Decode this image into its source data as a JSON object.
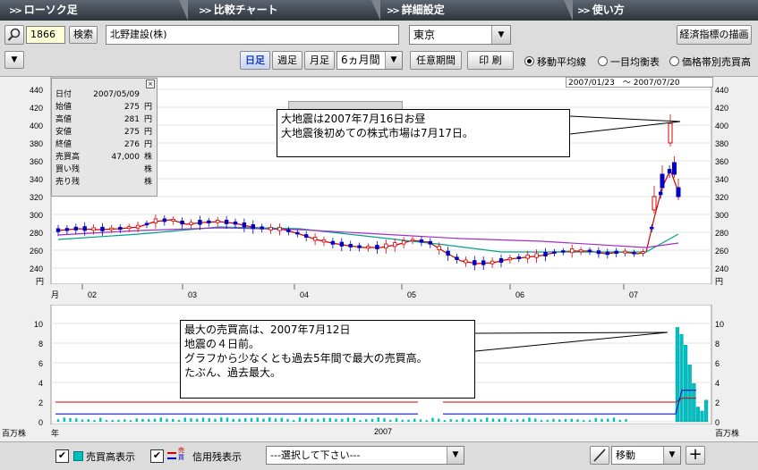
{
  "tabs": [
    {
      "label": "ローソク足",
      "active": true
    },
    {
      "label": "比較チャート"
    },
    {
      "label": "詳細設定"
    },
    {
      "label": "使い方"
    }
  ],
  "toolbar": {
    "code": "1866",
    "search_label": "検索",
    "company": "北野建設(株)",
    "market": "東京",
    "indicator_button": "経済指標の描画",
    "period_buttons": [
      "日足",
      "週足",
      "月足"
    ],
    "active_period": "日足",
    "range_select": "6ヵ月間",
    "custom_period": "任意期間",
    "print": "印 刷",
    "radios": [
      {
        "label": "移動平均線",
        "checked": true
      },
      {
        "label": "一目均衡表",
        "checked": false
      },
      {
        "label": "価格帯別売買高",
        "checked": false
      }
    ]
  },
  "date_range": "2007/01/23　～ 2007/07/20",
  "price_axis": {
    "ticks": [
      "440",
      "420",
      "400",
      "380",
      "360",
      "340",
      "320",
      "300",
      "280",
      "260",
      "240"
    ],
    "unit": "円"
  },
  "volume_axis": {
    "ticks": [
      "10",
      "8",
      "6",
      "4",
      "2",
      "0"
    ],
    "unit": "百万株"
  },
  "month_axis": {
    "label": "月",
    "months": [
      "02",
      "03",
      "04",
      "05",
      "06",
      "07"
    ]
  },
  "year_axis": {
    "label": "年",
    "year": "2007"
  },
  "info": {
    "rows": [
      {
        "k": "日付",
        "v": "2007/05/09",
        "u": ""
      },
      {
        "k": "始値",
        "v": "275",
        "u": "円"
      },
      {
        "k": "高値",
        "v": "281",
        "u": "円"
      },
      {
        "k": "安値",
        "v": "275",
        "u": "円"
      },
      {
        "k": "終値",
        "v": "276",
        "u": "円"
      },
      {
        "k": "売買高",
        "v": "47,000",
        "u": "株"
      },
      {
        "k": "買い残",
        "v": "",
        "u": "株"
      },
      {
        "k": "売り残",
        "v": "",
        "u": "株"
      }
    ]
  },
  "annotations": {
    "top": [
      "大地震は2007年7月16日お昼",
      "大地震後初めての株式市場は7月17日。"
    ],
    "bottom": [
      "最大の売買高は、2007年7月12日",
      "地震の４日前。",
      "グラフから少なくとも過去5年間で最大の売買高。",
      "たぶん、過去最大。"
    ]
  },
  "bottom": {
    "volume_label": "売買高表示",
    "volume_icon_color": "#00c0c0",
    "credit_label": "信用残表示",
    "credit_legend": [
      "売",
      "買"
    ],
    "select": "---選択して下さい---",
    "draw_mode": "移動"
  },
  "chart_data": [
    {
      "type": "line",
      "name": "price",
      "ylabel": "円",
      "ylim": [
        230,
        450
      ],
      "x_range": [
        "2007/01/23",
        "2007/07/20"
      ],
      "series": [
        {
          "name": "close",
          "color": "#d40000",
          "values": [
            [
              0,
              282
            ],
            [
              5,
              284
            ],
            [
              10,
              283
            ],
            [
              15,
              284
            ],
            [
              20,
              286
            ],
            [
              24,
              292
            ],
            [
              28,
              294
            ],
            [
              32,
              289
            ],
            [
              36,
              291
            ],
            [
              40,
              292
            ],
            [
              44,
              290
            ],
            [
              48,
              286
            ],
            [
              52,
              284
            ],
            [
              56,
              283
            ],
            [
              60,
              278
            ],
            [
              64,
              272
            ],
            [
              68,
              268
            ],
            [
              72,
              265
            ],
            [
              76,
              263
            ],
            [
              80,
              263
            ],
            [
              84,
              266
            ],
            [
              88,
              271
            ],
            [
              92,
              269
            ],
            [
              96,
              258
            ],
            [
              100,
              248
            ],
            [
              104,
              245
            ],
            [
              108,
              246
            ],
            [
              112,
              250
            ],
            [
              116,
              252
            ],
            [
              120,
              254
            ],
            [
              124,
              258
            ],
            [
              128,
              259
            ],
            [
              132,
              259
            ],
            [
              136,
              256
            ],
            [
              140,
              258
            ],
            [
              144,
              256
            ],
            [
              146,
              258
            ],
            [
              148,
              296
            ],
            [
              150,
              330
            ],
            [
              152,
              350
            ],
            [
              154,
              325
            ]
          ]
        },
        {
          "name": "ma-teal",
          "color": "#00a090",
          "values": [
            [
              0,
              272
            ],
            [
              20,
              278
            ],
            [
              40,
              286
            ],
            [
              60,
              284
            ],
            [
              80,
              274
            ],
            [
              96,
              266
            ],
            [
              110,
              258
            ],
            [
              130,
              258
            ],
            [
              146,
              258
            ],
            [
              154,
              278
            ]
          ]
        },
        {
          "name": "ma-purple",
          "color": "#a030c0",
          "values": [
            [
              0,
              277
            ],
            [
              20,
              282
            ],
            [
              40,
              285
            ],
            [
              60,
              283
            ],
            [
              80,
              278
            ],
            [
              100,
              273
            ],
            [
              120,
              270
            ],
            [
              146,
              263
            ],
            [
              154,
              268
            ]
          ]
        }
      ]
    },
    {
      "type": "bar",
      "name": "volume",
      "ylabel": "百万株",
      "ylim": [
        0,
        10
      ],
      "highlight_values": [
        9.6,
        8.9,
        7.8,
        5.8,
        3.9,
        1.5,
        1.1,
        2.2
      ],
      "credit_lines": [
        {
          "name": "売",
          "color": "#d40000",
          "level": 2.0
        },
        {
          "name": "買",
          "color": "#0000c0",
          "level": 0.8
        }
      ]
    }
  ]
}
